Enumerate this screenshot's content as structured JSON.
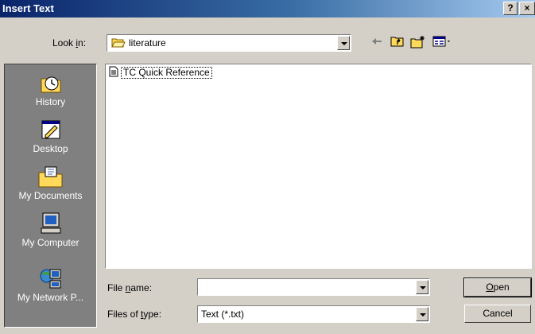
{
  "window": {
    "title": "Insert Text",
    "help_label": "?",
    "close_label": "×"
  },
  "lookin": {
    "label_pre": "Look ",
    "label_u": "i",
    "label_post": "n:",
    "value": "literature"
  },
  "places": [
    {
      "label": "History",
      "icon": "history-icon"
    },
    {
      "label": "Desktop",
      "icon": "desktop-icon"
    },
    {
      "label": "My Documents",
      "icon": "my-documents-icon"
    },
    {
      "label": "My Computer",
      "icon": "my-computer-icon"
    },
    {
      "label": "My Network P...",
      "icon": "my-network-places-icon"
    }
  ],
  "files": [
    {
      "name": "TC Quick Reference",
      "icon": "text-file-icon"
    }
  ],
  "filename": {
    "label_pre": "File ",
    "label_u": "n",
    "label_post": "ame:",
    "value": ""
  },
  "filetype": {
    "label_pre": "Files of ",
    "label_u": "t",
    "label_post": "ype:",
    "value": "Text (*.txt)"
  },
  "buttons": {
    "open_u": "O",
    "open_rest": "pen",
    "cancel": "Cancel"
  }
}
